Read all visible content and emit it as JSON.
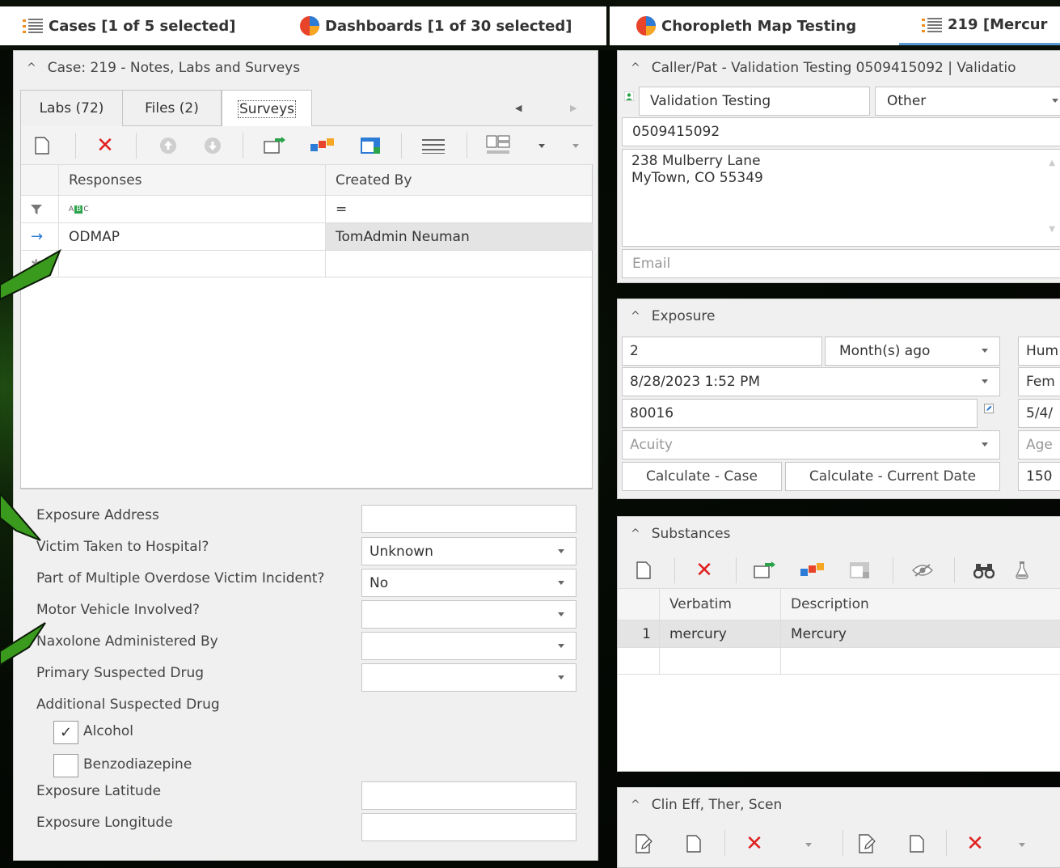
{
  "tabs": [
    {
      "label": "Cases [1 of 5 selected]",
      "icon": "list-icon"
    },
    {
      "label": "Dashboards [1 of 30 selected]",
      "icon": "dashboard-pie-icon"
    },
    {
      "label": "Choropleth Map Testing",
      "icon": "dashboard-pie-icon"
    },
    {
      "label": "219 [Mercur",
      "icon": "list-icon"
    }
  ],
  "left_panel": {
    "title": "Case: 219 - Notes, Labs and Surveys",
    "subtabs": [
      "Labs (72)",
      "Files (2)",
      "Surveys"
    ],
    "grid": {
      "columns": [
        "Responses",
        "Created By"
      ],
      "filter_values": [
        "",
        "="
      ],
      "rows": [
        {
          "response": "ODMAP",
          "created_by": "TomAdmin Neuman"
        }
      ]
    },
    "form": {
      "exposure_address_label": "Exposure Address",
      "victim_hospital_label": "Victim Taken to Hospital?",
      "victim_hospital_value": "Unknown",
      "multiple_overdose_label": "Part of Multiple Overdose Victim Incident?",
      "multiple_overdose_value": "No",
      "motor_vehicle_label": "Motor Vehicle Involved?",
      "naxolone_label": "Naxolone Administered By",
      "primary_drug_label": "Primary Suspected Drug",
      "additional_drug_label": "Additional Suspected Drug",
      "alcohol_label": "Alcohol",
      "alcohol_checked": true,
      "benzo_label": "Benzodiazepine",
      "benzo_checked": false,
      "latitude_label": "Exposure Latitude",
      "longitude_label": "Exposure Longitude"
    }
  },
  "caller_panel": {
    "title": "Caller/Pat - Validation Testing 0509415092 | Validatio",
    "name": "Validation Testing",
    "type": "Other",
    "phone": "0509415092",
    "address_line1": "238 Mulberry Lane",
    "address_line2": "MyTown, CO 55349",
    "email_placeholder": "Email"
  },
  "exposure_panel": {
    "title": "Exposure",
    "amount": "2",
    "unit": "Month(s) ago",
    "datetime": "8/28/2023 1:52 PM",
    "zip": "80016",
    "acuity_placeholder": "Acuity",
    "calc_case_label": "Calculate - Case",
    "calc_current_label": "Calculate - Current Date",
    "right_col": [
      "Hum",
      "Fem",
      "5/4/",
      "Age",
      "150"
    ]
  },
  "substances_panel": {
    "title": "Substances",
    "columns": [
      "Verbatim",
      "Description"
    ],
    "rows": [
      {
        "num": "1",
        "verbatim": "mercury",
        "description": "Mercury"
      }
    ]
  },
  "clin_panel": {
    "title": "Clin Eff, Ther, Scen"
  }
}
